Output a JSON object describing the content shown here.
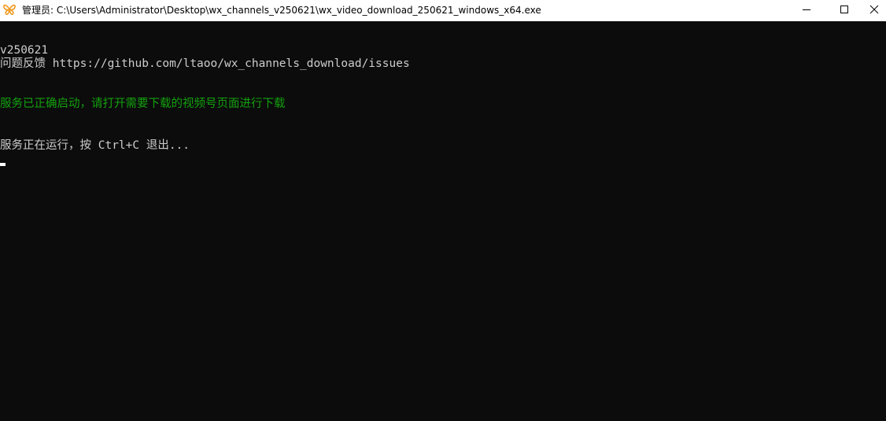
{
  "window": {
    "title": "管理员: C:\\Users\\Administrator\\Desktop\\wx_channels_v250621\\wx_video_download_250621_windows_x64.exe",
    "app_icon": "butterfly-icon",
    "controls": {
      "minimize": "minimize-icon",
      "maximize": "maximize-icon",
      "close": "close-icon"
    }
  },
  "console": {
    "lines": {
      "version": "v250621",
      "feedback": "问题反馈 https://github.com/ltaoo/wx_channels_download/issues",
      "status": "服务已正确启动，请打开需要下载的视频号页面进行下载",
      "running": "服务正在运行，按 Ctrl+C 退出..."
    },
    "colors": {
      "background": "#0c0c0c",
      "text": "#cccccc",
      "success": "#13a10e"
    }
  }
}
